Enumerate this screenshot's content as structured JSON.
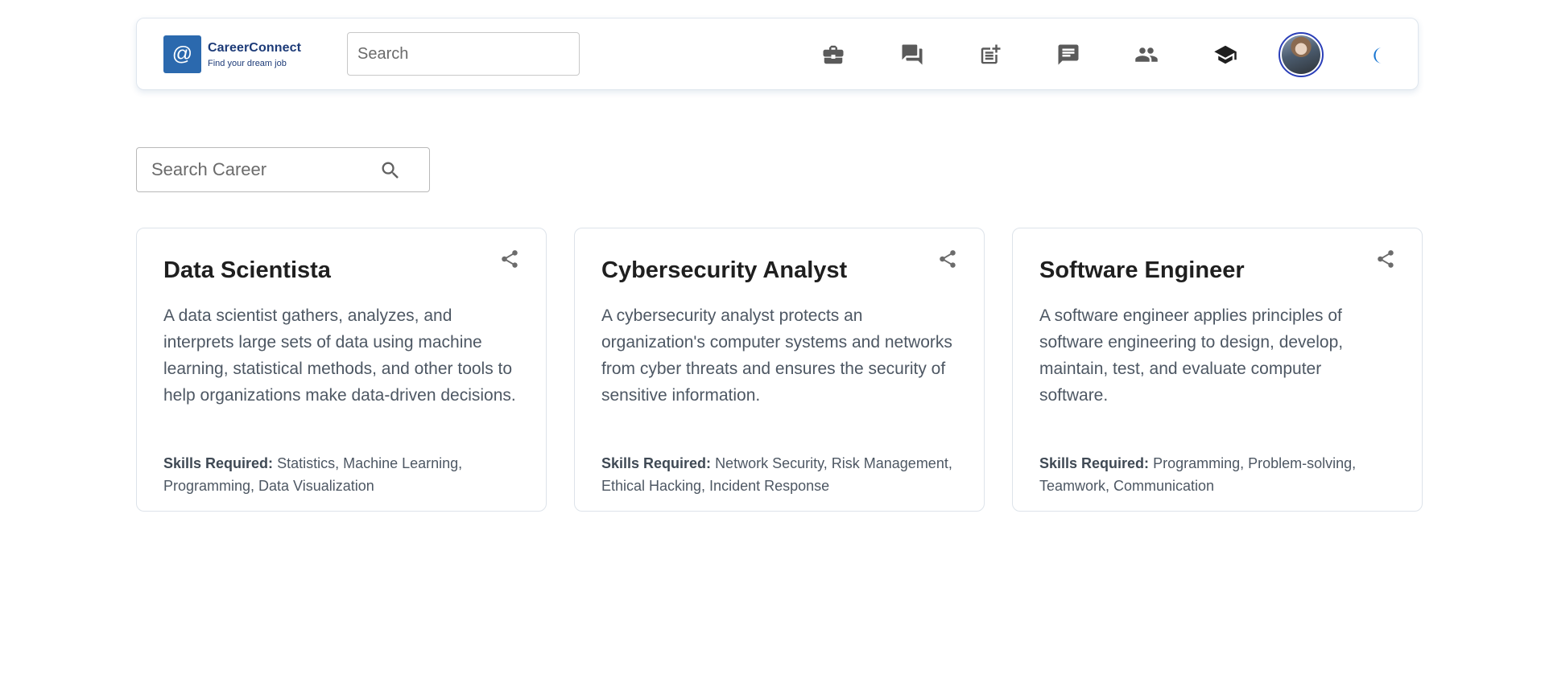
{
  "header": {
    "logo": {
      "mark": "@",
      "name": "CareerConnect",
      "tagline": "Find your dream job"
    },
    "search_placeholder": "Search",
    "nav_icons": [
      "briefcase-icon",
      "forum-icon",
      "post-add-icon",
      "chat-icon",
      "people-icon",
      "school-icon"
    ],
    "avatar": "user-avatar",
    "theme_toggle": "moon-icon",
    "accent_color": "#1976d2"
  },
  "career_search": {
    "placeholder": "Search Career"
  },
  "careers": [
    {
      "title": "Data Scientista",
      "description": "A data scientist gathers, analyzes, and interprets large sets of data using machine learning, statistical methods, and other tools to help organizations make data-driven decisions.",
      "skills_label": "Skills Required:",
      "skills": "Statistics, Machine Learning, Programming, Data Visualization"
    },
    {
      "title": "Cybersecurity Analyst",
      "description": "A cybersecurity analyst protects an organization's computer systems and networks from cyber threats and ensures the security of sensitive information.",
      "skills_label": "Skills Required:",
      "skills": "Network Security, Risk Management, Ethical Hacking, Incident Response"
    },
    {
      "title": "Software Engineer",
      "description": "A software engineer applies principles of software engineering to design, develop, maintain, test, and evaluate computer software.",
      "skills_label": "Skills Required:",
      "skills": "Programming, Problem-solving, Teamwork, Communication"
    }
  ]
}
